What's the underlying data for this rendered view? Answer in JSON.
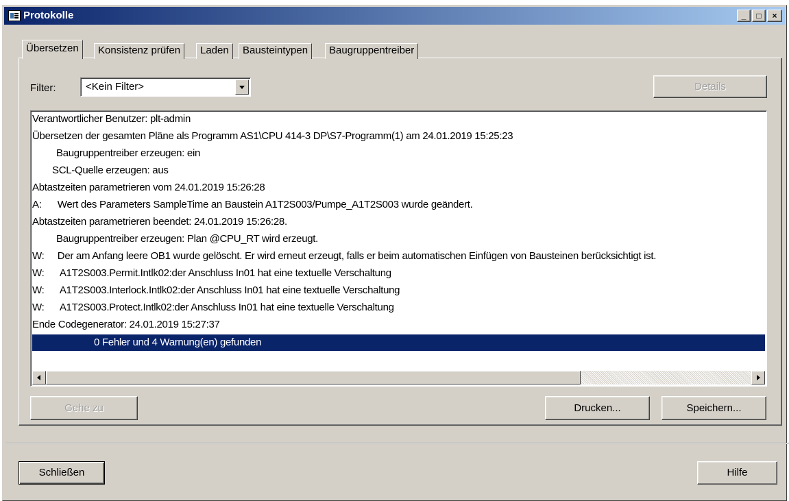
{
  "window": {
    "title": "Protokolle"
  },
  "caption_buttons": {
    "minimize": "_",
    "maximize": "□",
    "close": "×"
  },
  "tabs": [
    {
      "label": "Übersetzen",
      "active": true
    },
    {
      "label": "Konsistenz prüfen",
      "active": false
    },
    {
      "label": "Laden",
      "active": false
    },
    {
      "label": "Bausteintypen",
      "active": false
    },
    {
      "label": "Baugruppentreiber",
      "active": false
    }
  ],
  "filter": {
    "label": "Filter:",
    "value": "<Kein Filter>"
  },
  "buttons": {
    "details": "Details",
    "goto": "Gehe zu",
    "print": "Drucken...",
    "save": "Speichern...",
    "close": "Schließen",
    "help": "Hilfe"
  },
  "log": {
    "lines": [
      {
        "text": "Verantwortlicher Benutzer: plt-admin"
      },
      {
        "text": "Übersetzen der gesamten Pläne als Programm AS1\\CPU 414-3 DP\\S7-Programm(1) am 24.01.2019 15:25:23"
      },
      {
        "text": "Baugruppentreiber erzeugen: ein"
      },
      {
        "text": "SCL-Quelle erzeugen: aus"
      },
      {
        "text": "Abtastzeiten parametrieren vom 24.01.2019 15:26:28"
      },
      {
        "text": "A:      Wert des Parameters SampleTime an Baustein A1T2S003/Pumpe_A1T2S003 wurde geändert."
      },
      {
        "text": "Abtastzeiten parametrieren beendet: 24.01.2019 15:26:28."
      },
      {
        "text": "Baugruppentreiber erzeugen: Plan @CPU_RT wird erzeugt."
      },
      {
        "text": "W:     Der am Anfang leere OB1 wurde gelöscht. Er wird erneut erzeugt, falls er beim automatischen Einfügen von Bausteinen berücksichtigt ist."
      },
      {
        "text": "W:      A1T2S003.Permit.Intlk02:der Anschluss In01 hat eine textuelle Verschaltung"
      },
      {
        "text": "W:      A1T2S003.Interlock.Intlk02:der Anschluss In01 hat eine textuelle Verschaltung"
      },
      {
        "text": "W:      A1T2S003.Protect.Intlk02:der Anschluss In01 hat eine textuelle Verschaltung"
      },
      {
        "text": "Ende Codegenerator: 24.01.2019 15:27:37"
      },
      {
        "text": "0 Fehler und 4 Warnung(en) gefunden",
        "selected": true
      }
    ]
  },
  "colors": {
    "title_start": "#0a246a",
    "title_end": "#a6caf0",
    "selection": "#0a246a",
    "face": "#d4d0c8"
  }
}
